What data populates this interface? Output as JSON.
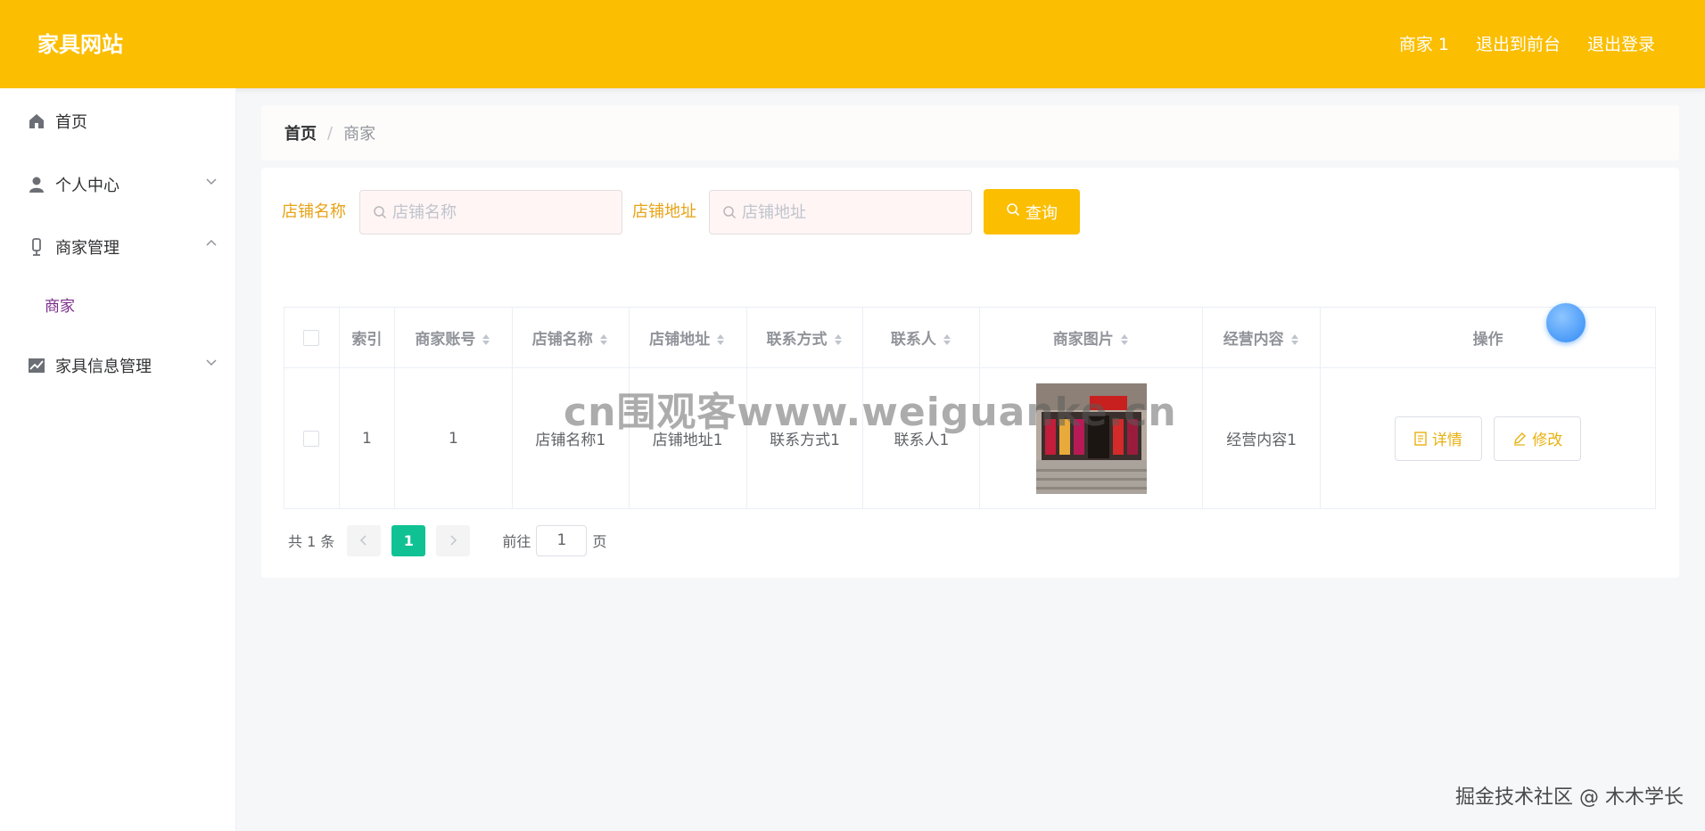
{
  "header": {
    "logo": "家具网站",
    "user": "商家 1",
    "back_to_front": "退出到前台",
    "logout": "退出登录"
  },
  "sidebar": {
    "items": [
      {
        "label": "首页",
        "icon": "home-icon"
      },
      {
        "label": "个人中心",
        "icon": "user-icon"
      },
      {
        "label": "商家管理",
        "icon": "mic-icon"
      },
      {
        "label": "家具信息管理",
        "icon": "chart-icon"
      }
    ],
    "sub_item": "商家"
  },
  "breadcrumb": {
    "home": "首页",
    "separator": "/",
    "current": "商家"
  },
  "search": {
    "name_label": "店铺名称",
    "name_placeholder": "店铺名称",
    "address_label": "店铺地址",
    "address_placeholder": "店铺地址",
    "button": "查询"
  },
  "table": {
    "headers": [
      "索引",
      "商家账号",
      "店铺名称",
      "店铺地址",
      "联系方式",
      "联系人",
      "商家图片",
      "经营内容",
      "操作"
    ],
    "rows": [
      {
        "index": "1",
        "account": "1",
        "shop_name": "店铺名称1",
        "address": "店铺地址1",
        "contact": "联系方式1",
        "person": "联系人1",
        "content": "经营内容1"
      }
    ],
    "detail_button": "详情",
    "edit_button": "修改"
  },
  "pagination": {
    "total": "共 1 条",
    "current": "1",
    "goto_label": "前往",
    "goto_value": "1",
    "page_suffix": "页"
  },
  "watermark": "cn围观客www.weiguanke.cn",
  "footer_mark": "掘金技术社区 @ 木木学长",
  "colors": {
    "accent": "#fbbe00",
    "active_page": "#10c293",
    "submenu": "#7b2d8b"
  }
}
